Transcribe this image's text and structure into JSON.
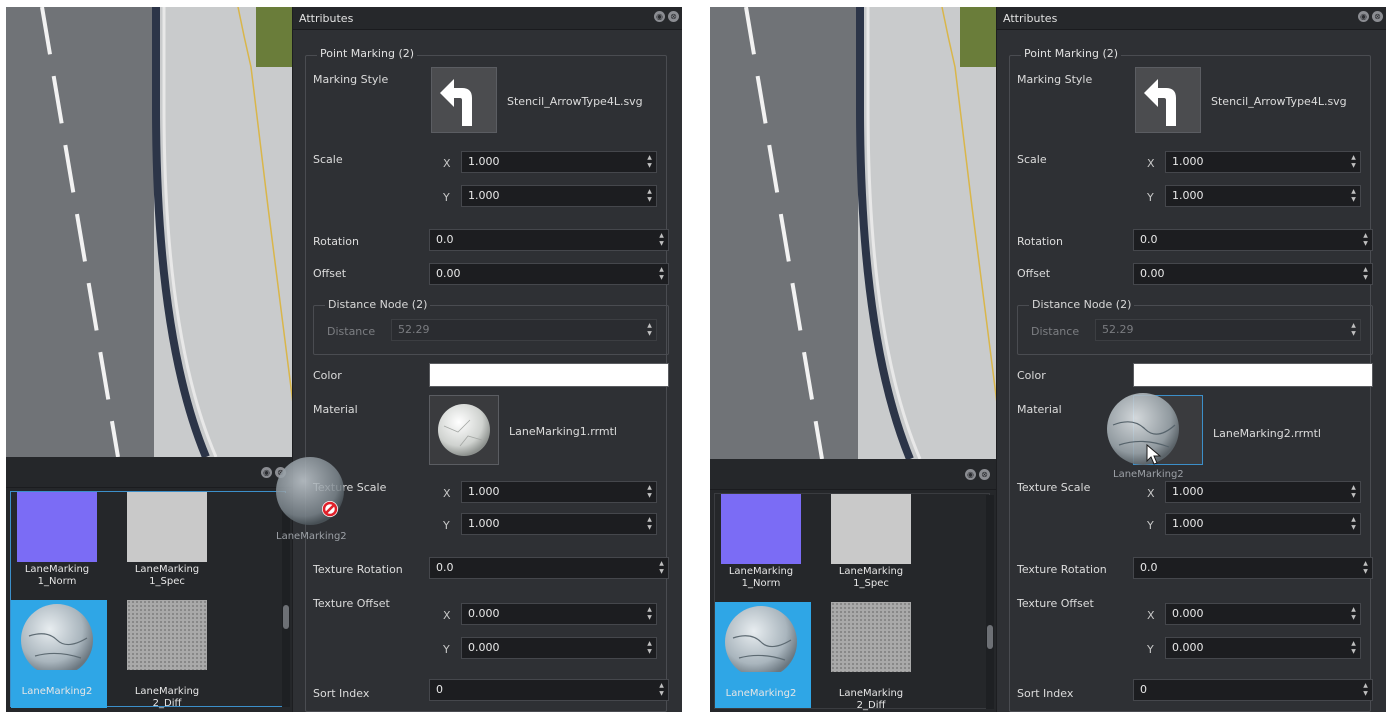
{
  "attributes": {
    "title": "Attributes",
    "header_buttons": [
      "◉",
      "⊗"
    ]
  },
  "point_marking": {
    "group_title": "Point Marking (2)",
    "marking_style_label": "Marking Style",
    "marking_style_file": "Stencil_ArrowType4L.svg",
    "scale_label": "Scale",
    "scale_x": "1.000",
    "scale_y": "1.000",
    "rotation_label": "Rotation",
    "rotation_value": "0.0",
    "offset_label": "Offset",
    "offset_value": "0.00",
    "distance_node_title": "Distance Node (2)",
    "distance_label": "Distance",
    "distance_value": "52.29",
    "color_label": "Color",
    "color_value": "#ffffff",
    "material_label": "Material",
    "texture_scale_label": "Texture Scale",
    "texture_scale_x": "1.000",
    "texture_scale_y": "1.000",
    "texture_rotation_label": "Texture Rotation",
    "texture_rotation_value": "0.0",
    "texture_offset_label": "Texture Offset",
    "texture_offset_x": "0.000",
    "texture_offset_y": "0.000",
    "sort_index_label": "Sort Index",
    "sort_index_value": "0",
    "axis_x": "X",
    "axis_y": "Y"
  },
  "left_shot": {
    "material_file": "LaneMarking1.rrmtl",
    "drag_label": "LaneMarking2"
  },
  "right_shot": {
    "material_file": "LaneMarking2.rrmtl",
    "drag_label": "LaneMarking2"
  },
  "browser": {
    "header_buttons": [
      "◉",
      "⊗"
    ],
    "assets": [
      {
        "name": "LaneMarking\n1_Norm",
        "name_l1": "LaneMarking",
        "name_l2": "1_Norm",
        "kind": "normal"
      },
      {
        "name": "LaneMarking\n1_Spec",
        "name_l1": "LaneMarking",
        "name_l2": "1_Spec",
        "kind": "spec"
      },
      {
        "name": "LaneMarking2",
        "name_l1": "LaneMarking2",
        "name_l2": "",
        "kind": "material",
        "selected": true
      },
      {
        "name": "LaneMarking\n2_Diff",
        "name_l1": "LaneMarking",
        "name_l2": "2_Diff",
        "kind": "diffuse"
      }
    ]
  },
  "colors": {
    "panel_bg": "#2e3034",
    "selection_blue": "#2fa6e6",
    "browser_border": "#3c8fc9",
    "normal_map": "#7b6cf5",
    "road_asphalt": "#6e7176",
    "curb_line_yellow": "#d9b64a",
    "grass": "#6a7d3a"
  }
}
